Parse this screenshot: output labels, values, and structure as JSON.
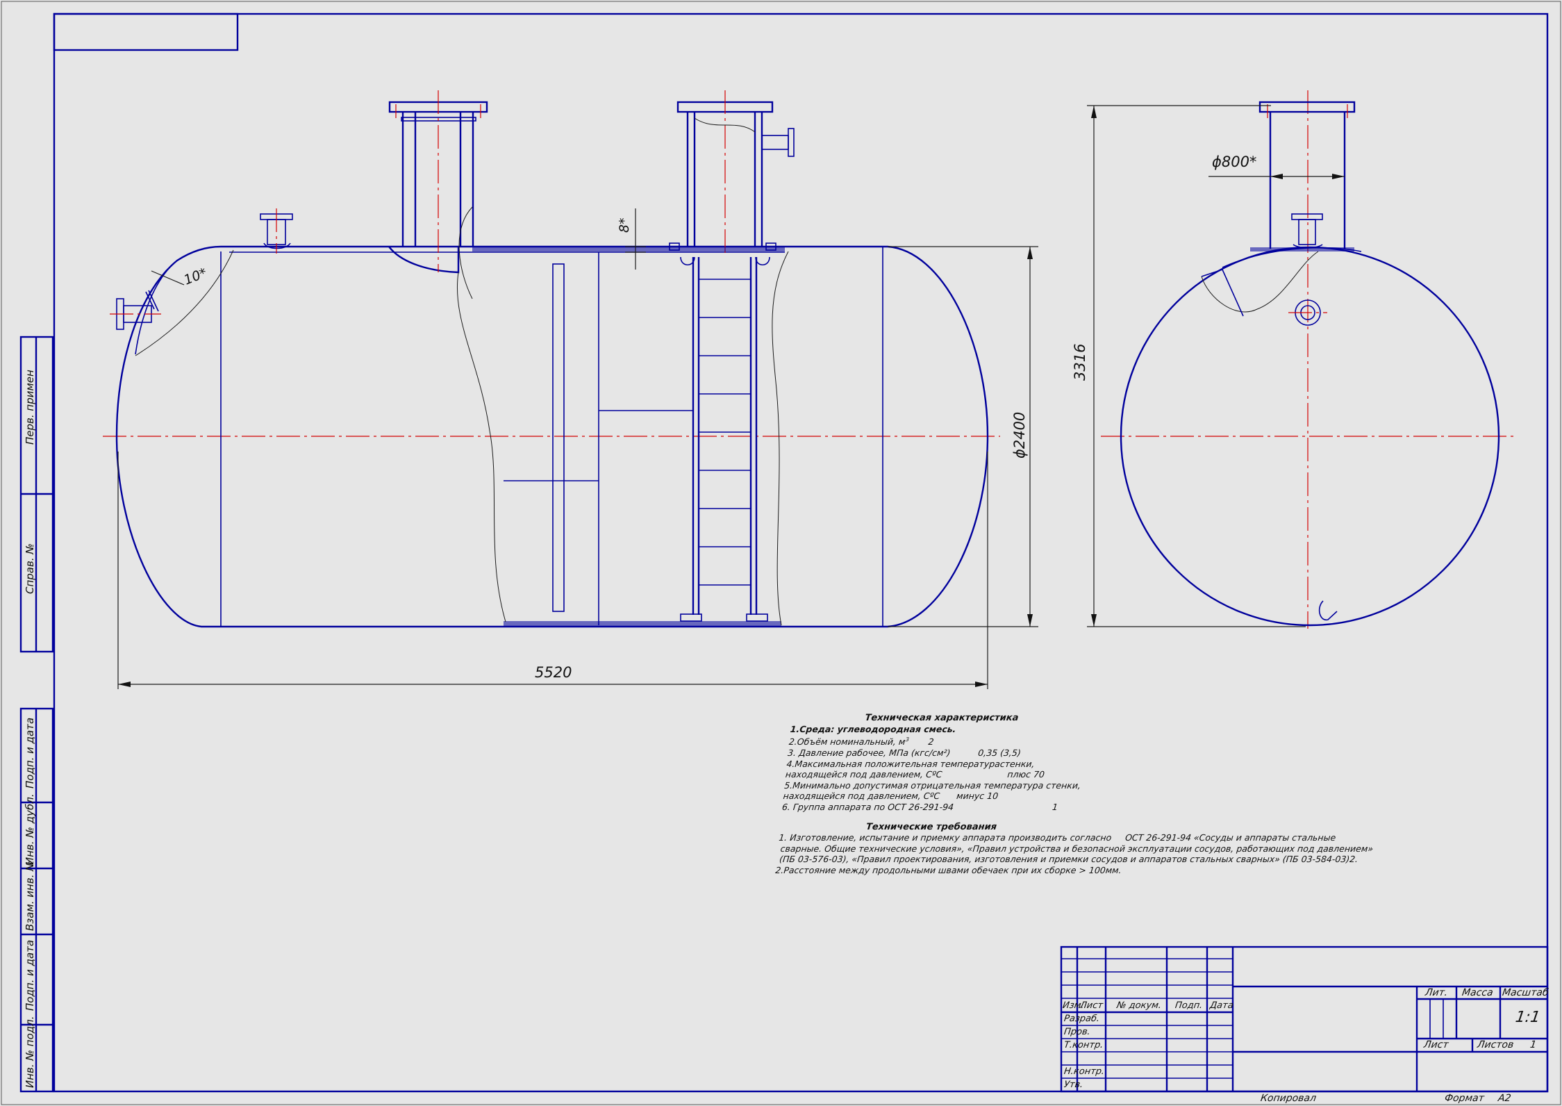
{
  "dimensions": {
    "length": "5520",
    "diameter": "ϕ2400",
    "height": "3316",
    "nozzle_diameter": "ϕ800*",
    "wall_thickness_shell": "8*",
    "wall_thickness_head": "10*"
  },
  "specs": {
    "title": "Техническая характеристика",
    "line1": "1.Среда: углеводородная смесь.",
    "line2a": "2.Объём номинальный, м",
    "line2_sup": "3",
    "line2b": "2",
    "line3": "3. Давление рабочее, МПа (кгс/см²)",
    "line3_val": "0,35 (3,5)",
    "line4a": "4.Максимальная положительная температурастенки,",
    "line4b": "находящейся под давлением, СºС",
    "line4_val": "плюс 70",
    "line5a": "5.Минимально допустимая отрицательная температура стенки,",
    "line5b": "находящейся под давлением, СºС",
    "line5_val": "минус 10",
    "line6": "6. Группа аппарата по ОСТ 26-291-94",
    "line6_val": "1"
  },
  "requirements": {
    "title": "Технические требования",
    "line1": "1. Изготовление, испытание и приемку аппарата производить согласно     ОСТ 26-291-94 «Сосуды и аппараты стальные",
    "line2": " сварные. Общие технические условия», «Правил устройства и безопасной эксплуатации сосудов, работающих под давлением»",
    "line3": " (ПБ 03-576-03), «Правил проектирования, изготовления и приемки сосудов и аппаратов стальных сварных» (ПБ 03-584-03)2.",
    "line4": "2.Расстояние между продольными швами обечаек при их сборке > 100мм."
  },
  "title_block": {
    "izm": "Изм.",
    "list": "Лист",
    "doc_no": "№ докум.",
    "podp": "Подп.",
    "data": "Дата",
    "razrab": "Разраб.",
    "prov": "Пров.",
    "tkontr": "Т.контр.",
    "nkontr": "Н.контр.",
    "utv": "Утв.",
    "lit": "Лит.",
    "massa": "Масса",
    "masshtab": "Масштаб",
    "scale_value": "1:1",
    "sheet": "Лист",
    "sheets": "Листов",
    "sheets_value": "1",
    "copied": "Копировал",
    "format": "Формат",
    "format_value": "А2"
  },
  "side_labels": {
    "perv_primen": "Перв. примен",
    "sprav_no": "Справ. №",
    "podp_data_1": "Подп. и дата",
    "inv_dubl": "Инв. № дубл.",
    "vzam_inv": "Взам. инв. №",
    "podp_data_2": "Подп. и дата",
    "inv_podl": "Инв. № подл."
  },
  "colors": {
    "line": "#00009c",
    "axis": "#d40000",
    "background": "#e6e6e6"
  }
}
